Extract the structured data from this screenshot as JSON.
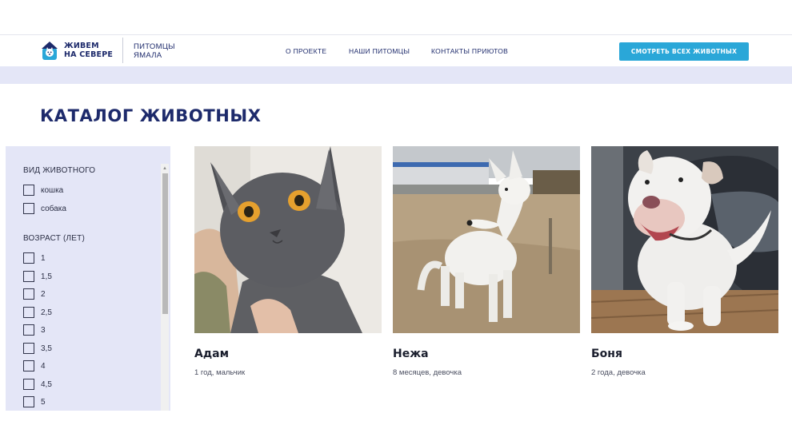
{
  "header": {
    "logo_line1": "ЖИВЕМ",
    "logo_line2": "НА СЕВЕРЕ",
    "logo_sub_line1": "ПИТОМЦЫ",
    "logo_sub_line2": "ЯМАЛА",
    "nav": [
      "О ПРОЕКТЕ",
      "НАШИ ПИТОМЦЫ",
      "КОНТАКТЫ ПРИЮТОВ"
    ],
    "cta_label": "СМОТРЕТЬ ВСЕХ ЖИВОТНЫХ"
  },
  "page_title": "КАТАЛОГ ЖИВОТНЫХ",
  "filters": {
    "species_title": "ВИД ЖИВОТНОГО",
    "species": [
      "кошка",
      "собака"
    ],
    "age_title": "ВОЗРАСТ (ЛЕТ)",
    "ages": [
      "1",
      "1,5",
      "2",
      "2,5",
      "3",
      "3,5",
      "4",
      "4,5",
      "5"
    ]
  },
  "cards": [
    {
      "name": "Адам",
      "desc": "1 год, мальчик"
    },
    {
      "name": "Нежа",
      "desc": "8 месяцев, девочка"
    },
    {
      "name": "Боня",
      "desc": "2 года, девочка"
    }
  ],
  "colors": {
    "brand": "#1d2a6b",
    "cta": "#2aa7d8",
    "band": "#e4e6f7"
  }
}
